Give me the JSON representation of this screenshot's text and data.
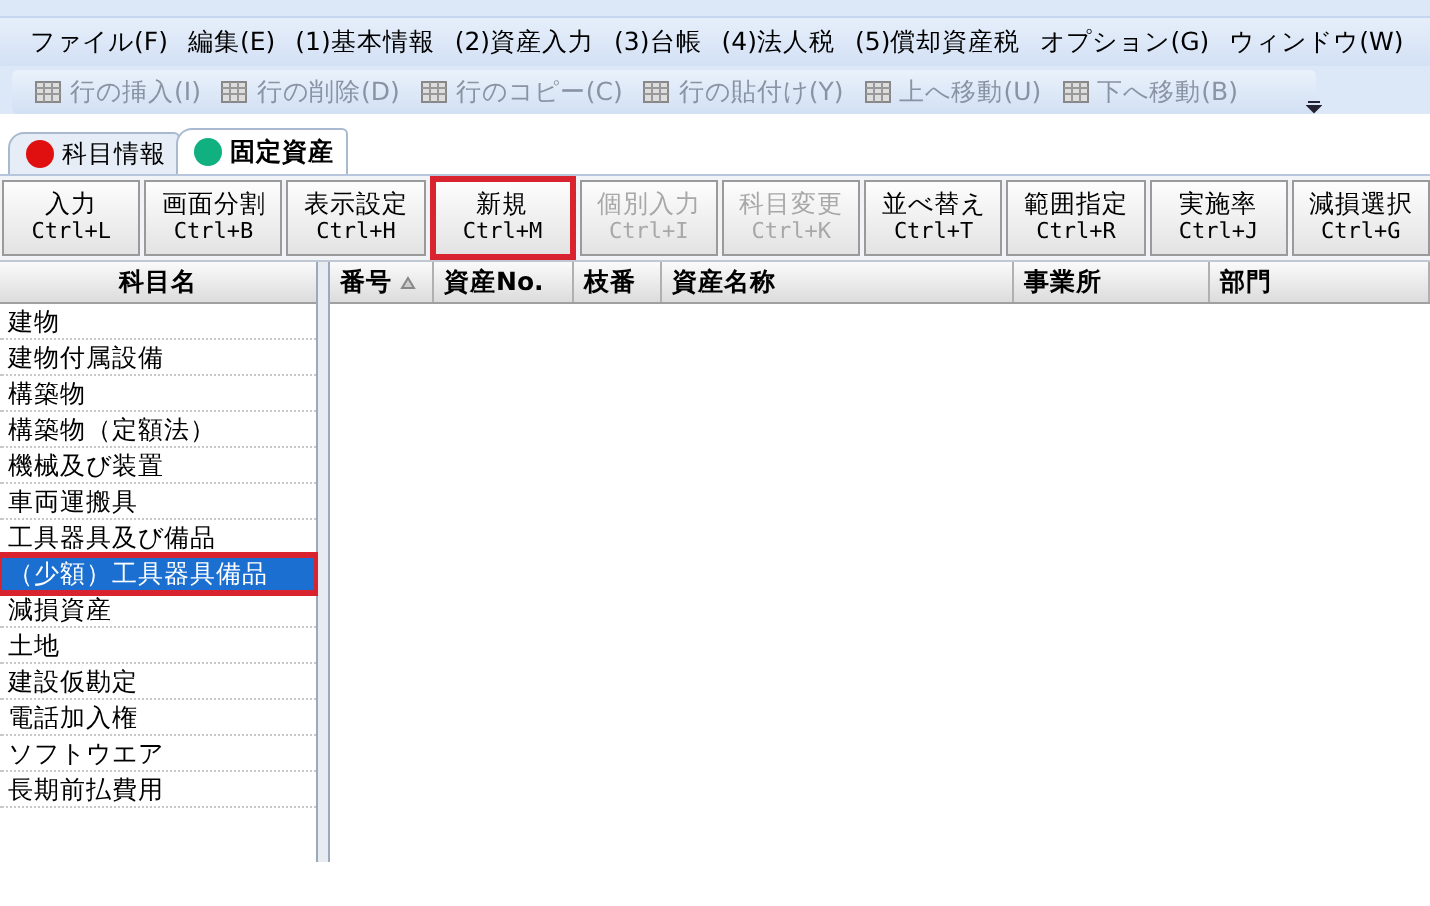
{
  "menu_bar": [
    "ファイル(F)",
    "編集(E)",
    "(1)基本情報",
    "(2)資産入力",
    "(3)台帳",
    "(4)法人税",
    "(5)償却資産税",
    "オプション(G)",
    "ウィンドウ(W)"
  ],
  "toolbar": [
    {
      "label": "行の挿入(I)",
      "disabled": true
    },
    {
      "label": "行の削除(D)",
      "disabled": true
    },
    {
      "label": "行のコピー(C)",
      "disabled": true
    },
    {
      "label": "行の貼付け(Y)",
      "disabled": true
    },
    {
      "label": "上へ移動(U)",
      "disabled": true
    },
    {
      "label": "下へ移動(B)",
      "disabled": true
    }
  ],
  "tabs": [
    {
      "label": "科目情報",
      "selected": false,
      "color": "#e01010"
    },
    {
      "label": "固定資産",
      "selected": true,
      "color": "#10b080"
    }
  ],
  "buttons": [
    {
      "label": "入力",
      "shortcut": "Ctrl+L",
      "disabled": false,
      "highlighted": false
    },
    {
      "label": "画面分割",
      "shortcut": "Ctrl+B",
      "disabled": false,
      "highlighted": false
    },
    {
      "label": "表示設定",
      "shortcut": "Ctrl+H",
      "disabled": false,
      "highlighted": false
    },
    {
      "label": "新規",
      "shortcut": "Ctrl+M",
      "disabled": false,
      "highlighted": true
    },
    {
      "label": "個別入力",
      "shortcut": "Ctrl+I",
      "disabled": true,
      "highlighted": false
    },
    {
      "label": "科目変更",
      "shortcut": "Ctrl+K",
      "disabled": true,
      "highlighted": false
    },
    {
      "label": "並べ替え",
      "shortcut": "Ctrl+T",
      "disabled": false,
      "highlighted": false
    },
    {
      "label": "範囲指定",
      "shortcut": "Ctrl+R",
      "disabled": false,
      "highlighted": false
    },
    {
      "label": "実施率",
      "shortcut": "Ctrl+J",
      "disabled": false,
      "highlighted": false
    },
    {
      "label": "減損選択",
      "shortcut": "Ctrl+G",
      "disabled": false,
      "highlighted": false
    }
  ],
  "account_list": {
    "header": "科目名",
    "items": [
      {
        "label": "建物",
        "selected": false,
        "highlighted": false
      },
      {
        "label": "建物付属設備",
        "selected": false,
        "highlighted": false
      },
      {
        "label": "構築物",
        "selected": false,
        "highlighted": false
      },
      {
        "label": "構築物（定額法）",
        "selected": false,
        "highlighted": false
      },
      {
        "label": "機械及び装置",
        "selected": false,
        "highlighted": false
      },
      {
        "label": "車両運搬具",
        "selected": false,
        "highlighted": false
      },
      {
        "label": "工具器具及び備品",
        "selected": false,
        "highlighted": false
      },
      {
        "label": "（少額）工具器具備品",
        "selected": true,
        "highlighted": true
      },
      {
        "label": "減損資産",
        "selected": false,
        "highlighted": false
      },
      {
        "label": "土地",
        "selected": false,
        "highlighted": false
      },
      {
        "label": "建設仮勘定",
        "selected": false,
        "highlighted": false
      },
      {
        "label": "電話加入権",
        "selected": false,
        "highlighted": false
      },
      {
        "label": "ソフトウエア",
        "selected": false,
        "highlighted": false
      },
      {
        "label": "長期前払費用",
        "selected": false,
        "highlighted": false
      }
    ]
  },
  "table": {
    "columns": [
      {
        "label": "番号",
        "sorted": true
      },
      {
        "label": "資産No.",
        "sorted": false
      },
      {
        "label": "枝番",
        "sorted": false
      },
      {
        "label": "資産名称",
        "sorted": false
      },
      {
        "label": "事業所",
        "sorted": false
      },
      {
        "label": "部門",
        "sorted": false
      }
    ]
  }
}
